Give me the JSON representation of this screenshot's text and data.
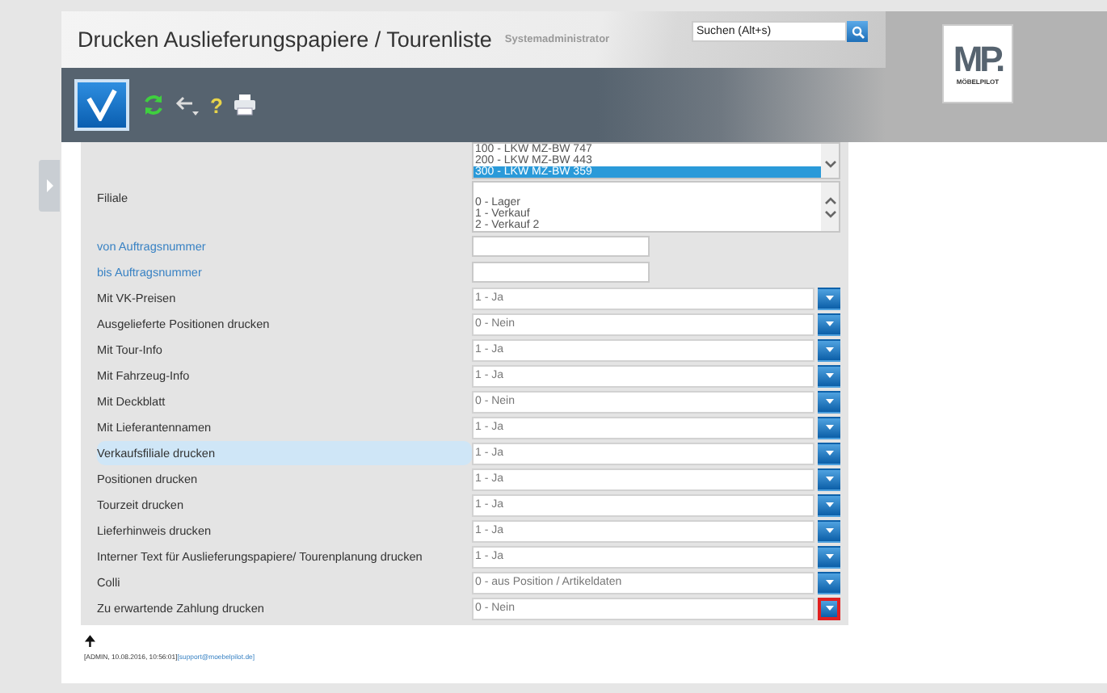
{
  "header": {
    "title": "Drucken Auslieferungspapiere / Tourenliste",
    "user": "Systemadministrator",
    "search": {
      "placeholder": "Suchen (Alt+s)"
    }
  },
  "toolbar": {
    "help": "?"
  },
  "logo": {
    "letters": "MP.",
    "name": "MÖBELPILOT"
  },
  "listboxes": [
    {
      "scroll_up": false,
      "scroll_down": true,
      "items": [
        {
          "text": "100 - LKW MZ-BW 747",
          "selected": false
        },
        {
          "text": "200 - LKW MZ-BW 443",
          "selected": false
        },
        {
          "text": "300 - LKW MZ-BW 359",
          "selected": true
        }
      ]
    },
    {
      "label": "Filiale",
      "scroll_up": true,
      "scroll_down": true,
      "items": [
        {
          "text": "0 - Lager",
          "selected": false
        },
        {
          "text": "1 - Verkauf",
          "selected": false
        },
        {
          "text": "2 - Verkauf 2",
          "selected": false
        }
      ]
    }
  ],
  "fields": [
    {
      "kind": "text",
      "label": "von Auftragsnummer"
    },
    {
      "kind": "text",
      "label": "bis Auftragsnummer"
    },
    {
      "kind": "select",
      "label": "Mit VK-Preisen",
      "value": "1 - Ja",
      "highlighted": false,
      "marked": false
    },
    {
      "kind": "select",
      "label": "Ausgelieferte Positionen drucken",
      "value": "0 - Nein",
      "highlighted": false,
      "marked": false
    },
    {
      "kind": "select",
      "label": "Mit Tour-Info",
      "value": "1 - Ja",
      "highlighted": false,
      "marked": false
    },
    {
      "kind": "select",
      "label": "Mit Fahrzeug-Info",
      "value": "1 - Ja",
      "highlighted": false,
      "marked": false
    },
    {
      "kind": "select",
      "label": "Mit Deckblatt",
      "value": "0 - Nein",
      "highlighted": false,
      "marked": false
    },
    {
      "kind": "select",
      "label": "Mit Lieferantennamen",
      "value": "1 - Ja",
      "highlighted": false,
      "marked": false
    },
    {
      "kind": "select",
      "label": "Verkaufsfiliale drucken",
      "value": "1 - Ja",
      "highlighted": true,
      "marked": false
    },
    {
      "kind": "select",
      "label": "Positionen drucken",
      "value": "1 - Ja",
      "highlighted": false,
      "marked": false
    },
    {
      "kind": "select",
      "label": "Tourzeit drucken",
      "value": "1 - Ja",
      "highlighted": false,
      "marked": false
    },
    {
      "kind": "select",
      "label": "Lieferhinweis drucken",
      "value": "1 - Ja",
      "highlighted": false,
      "marked": false
    },
    {
      "kind": "select",
      "label": "Interner Text für Auslieferungspapiere/ Tourenplanung drucken",
      "value": "1 - Ja",
      "highlighted": false,
      "marked": false
    },
    {
      "kind": "select",
      "label": "Colli",
      "value": "0 - aus Position / Artikeldaten",
      "highlighted": false,
      "marked": false
    },
    {
      "kind": "select",
      "label": "Zu erwartende Zahlung drucken",
      "value": "0 - Nein",
      "highlighted": false,
      "marked": true
    }
  ],
  "footer": {
    "arrow": "🠉",
    "stamp": "[ADMIN, 10.08.2016, 10:56:01]",
    "link": "[support@moebelpilot.de]"
  }
}
